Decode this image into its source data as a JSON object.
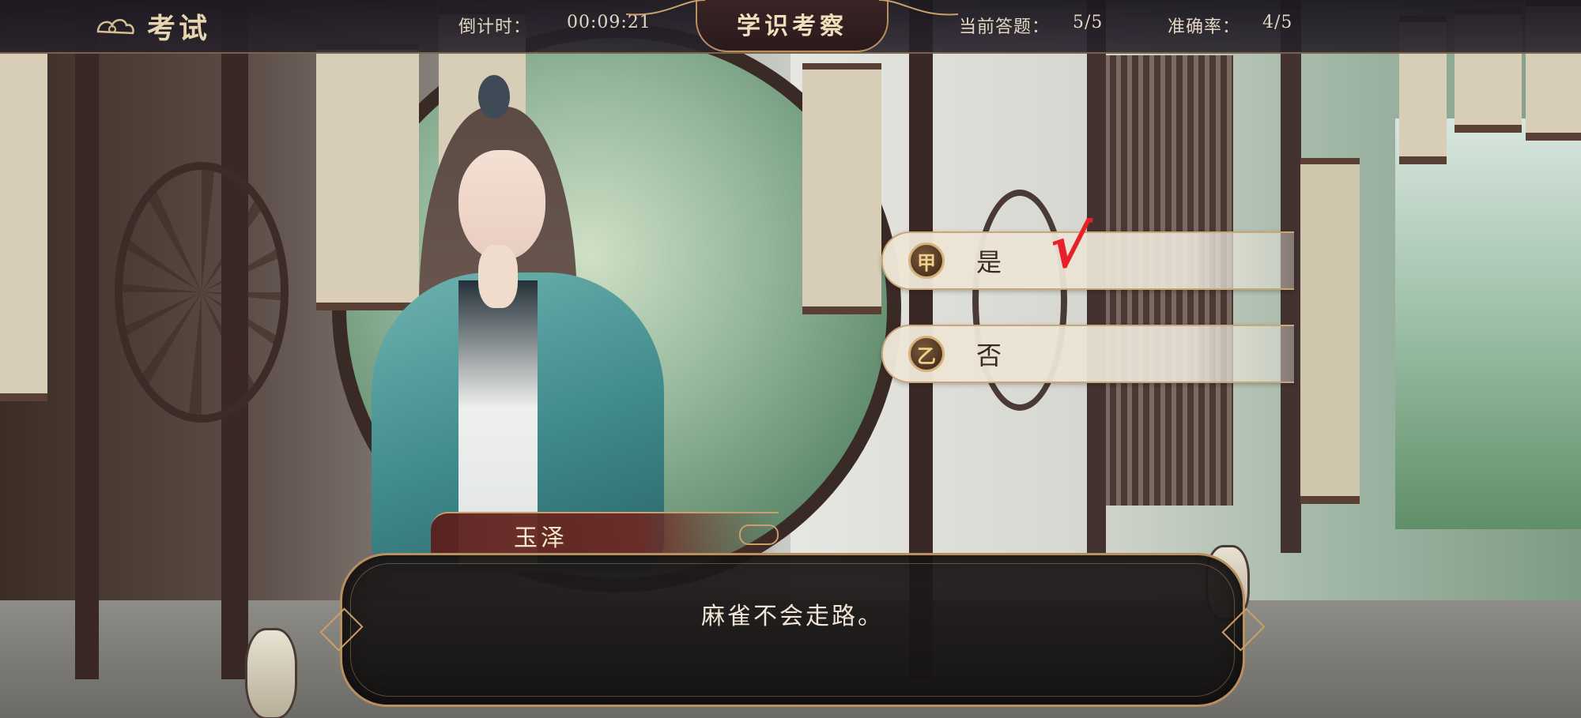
{
  "header": {
    "screen_title": "考试",
    "countdown_label": "倒计时：",
    "countdown_value": "00:09:21",
    "center_title": "学识考察",
    "current_question_label": "当前答题：",
    "current_question_value": "5/5",
    "accuracy_label": "准确率：",
    "accuracy_value": "4/5"
  },
  "options": [
    {
      "badge": "甲",
      "label": "是",
      "marked_correct": true
    },
    {
      "badge": "乙",
      "label": "否",
      "marked_correct": false
    }
  ],
  "check_mark": "√",
  "dialogue": {
    "speaker": "玉泽",
    "text": "麻雀不会走路。"
  },
  "colors": {
    "accent_gold": "#c9a676",
    "check_red": "#e8202a",
    "robe_teal": "#3f8a8c"
  }
}
